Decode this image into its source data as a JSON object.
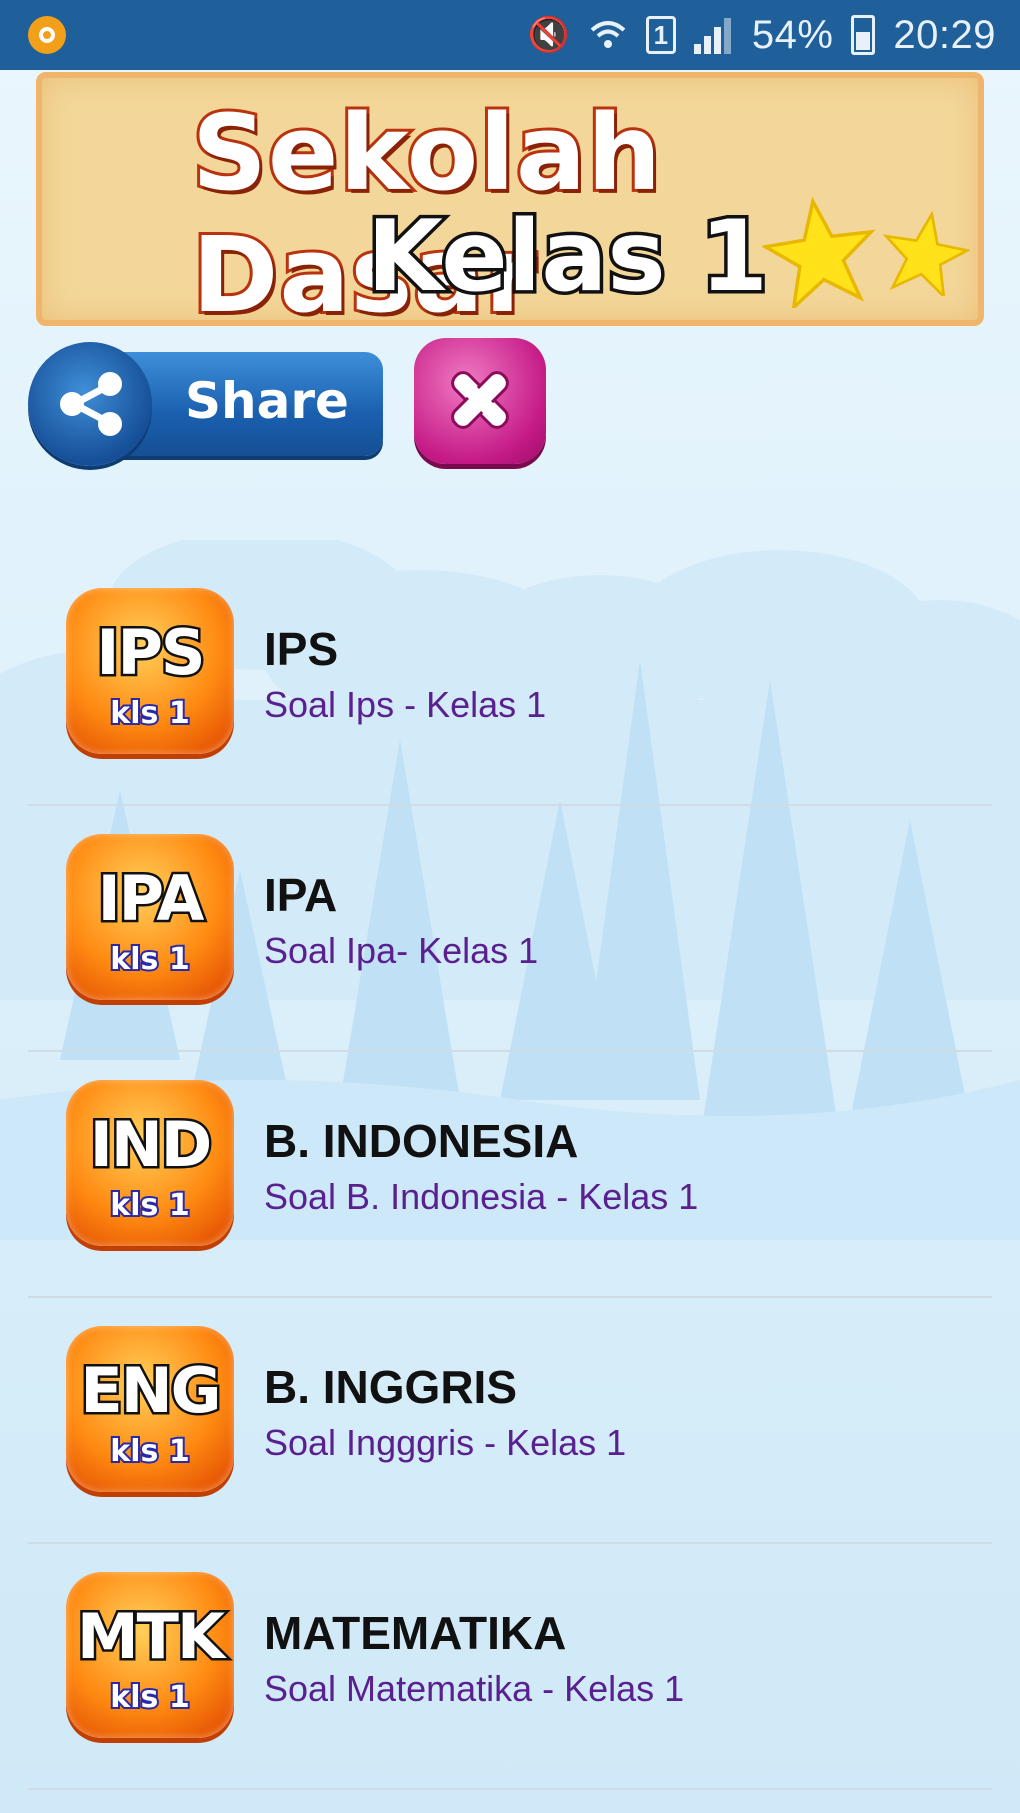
{
  "status_bar": {
    "battery": "54%",
    "time": "20:29",
    "sim_slot": "1"
  },
  "banner": {
    "title": "Sekolah Dasar",
    "subtitle": "Kelas 1"
  },
  "actions": {
    "share_label": "Share"
  },
  "subjects": [
    {
      "code": "IPS",
      "kls": "kls 1",
      "title": "IPS",
      "subtitle": "Soal Ips - Kelas 1"
    },
    {
      "code": "IPA",
      "kls": "kls 1",
      "title": "IPA",
      "subtitle": "Soal Ipa- Kelas 1"
    },
    {
      "code": "IND",
      "kls": "kls 1",
      "title": "B. INDONESIA",
      "subtitle": "Soal B. Indonesia - Kelas 1"
    },
    {
      "code": "ENG",
      "kls": "kls 1",
      "title": "B. INGGRIS",
      "subtitle": "Soal Ingggris - Kelas 1"
    },
    {
      "code": "MTK",
      "kls": "kls 1",
      "title": "MATEMATIKA",
      "subtitle": "Soal Matematika - Kelas 1"
    }
  ],
  "colors": {
    "status_bar": "#1f5f9a",
    "badge_orange": "#ff8a12",
    "subtitle_purple": "#5a2090",
    "share_blue": "#1a5fae",
    "close_pink": "#c51a86"
  }
}
